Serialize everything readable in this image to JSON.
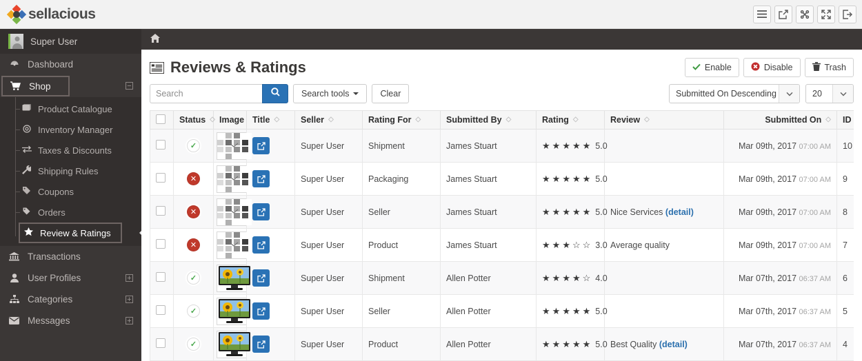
{
  "topbar": {
    "brand": "sellacious",
    "icons": [
      {
        "name": "menu-icon",
        "label": "Menu"
      },
      {
        "name": "external-link-icon",
        "label": "Preview site"
      },
      {
        "name": "joomla-icon",
        "label": "Joomla"
      },
      {
        "name": "fullscreen-icon",
        "label": "Fullscreen"
      },
      {
        "name": "logout-icon",
        "label": "Logout"
      }
    ]
  },
  "sidebar": {
    "user": "Super User",
    "items": [
      {
        "label": "Dashboard",
        "icon": "dashboard-icon",
        "boxed": false,
        "expander": null
      },
      {
        "label": "Shop",
        "icon": "cart-icon",
        "boxed": true,
        "expander": "minus"
      },
      {
        "label": "Transactions",
        "icon": "bank-icon",
        "boxed": false,
        "expander": null
      },
      {
        "label": "User Profiles",
        "icon": "user-icon",
        "boxed": false,
        "expander": "plus"
      },
      {
        "label": "Categories",
        "icon": "sitemap-icon",
        "boxed": false,
        "expander": "plus"
      },
      {
        "label": "Messages",
        "icon": "envelope-icon",
        "boxed": false,
        "expander": "plus"
      }
    ],
    "shop_submenu": [
      {
        "label": "Product Catalogue",
        "icon": "book-icon",
        "active": false
      },
      {
        "label": "Inventory Manager",
        "icon": "circle-icon",
        "active": false
      },
      {
        "label": "Taxes & Discounts",
        "icon": "exchange-icon",
        "active": false
      },
      {
        "label": "Shipping Rules",
        "icon": "wrench-icon",
        "active": false
      },
      {
        "label": "Coupons",
        "icon": "tags-icon",
        "active": false
      },
      {
        "label": "Orders",
        "icon": "tag-icon",
        "active": false
      },
      {
        "label": "Review & Ratings",
        "icon": "star-icon",
        "active": true
      }
    ]
  },
  "breadcrumb": {
    "home_icon": "home-icon"
  },
  "page": {
    "title": "Reviews & Ratings",
    "title_icon": "list-icon",
    "actions": [
      {
        "label": "Enable",
        "icon": "check-icon",
        "color": "#3f9b42"
      },
      {
        "label": "Disable",
        "icon": "times-circle-icon",
        "color": "#c22e2e"
      },
      {
        "label": "Trash",
        "icon": "trash-icon",
        "color": "#3f3f3f"
      }
    ]
  },
  "toolbar": {
    "search_placeholder": "Search",
    "search_value": "",
    "search_icon": "search-icon",
    "search_tools_label": "Search tools",
    "clear_label": "Clear",
    "sort_value": "Submitted On Descending",
    "limit_value": "20"
  },
  "table": {
    "columns": [
      {
        "key": "checkbox",
        "label": "",
        "sortable": false
      },
      {
        "key": "status",
        "label": "Status",
        "sortable": true
      },
      {
        "key": "image",
        "label": "Image",
        "sortable": false
      },
      {
        "key": "title",
        "label": "Title",
        "sortable": true
      },
      {
        "key": "seller",
        "label": "Seller",
        "sortable": true
      },
      {
        "key": "rating_for",
        "label": "Rating For",
        "sortable": true
      },
      {
        "key": "submitted_by",
        "label": "Submitted By",
        "sortable": true
      },
      {
        "key": "rating",
        "label": "Rating",
        "sortable": true
      },
      {
        "key": "review",
        "label": "Review",
        "sortable": true
      },
      {
        "key": "submitted_on",
        "label": "Submitted On",
        "sortable": true
      },
      {
        "key": "id",
        "label": "ID",
        "sortable": true
      }
    ],
    "rows": [
      {
        "status": "enabled",
        "image": "broken-collage",
        "seller": "Super User",
        "rating_for": "Shipment",
        "submitted_by": "James Stuart",
        "rating": 5.0,
        "rating_text": "5.0",
        "review": "",
        "review_link": "",
        "date": "Mar 09th, 2017",
        "time": "07:00 AM",
        "id": "10"
      },
      {
        "status": "disabled",
        "image": "broken-collage",
        "seller": "Super User",
        "rating_for": "Packaging",
        "submitted_by": "James Stuart",
        "rating": 5.0,
        "rating_text": "5.0",
        "review": "",
        "review_link": "",
        "date": "Mar 09th, 2017",
        "time": "07:00 AM",
        "id": "9"
      },
      {
        "status": "disabled",
        "image": "broken-collage",
        "seller": "Super User",
        "rating_for": "Seller",
        "submitted_by": "James Stuart",
        "rating": 5.0,
        "rating_text": "5.0",
        "review": "Nice Services",
        "review_link": "(detail)",
        "date": "Mar 09th, 2017",
        "time": "07:00 AM",
        "id": "8"
      },
      {
        "status": "disabled",
        "image": "broken-collage",
        "seller": "Super User",
        "rating_for": "Product",
        "submitted_by": "James Stuart",
        "rating": 3.0,
        "rating_text": "3.0",
        "review": "Average quality",
        "review_link": "",
        "date": "Mar 09th, 2017",
        "time": "07:00 AM",
        "id": "7"
      },
      {
        "status": "enabled",
        "image": "tv-sunflower",
        "seller": "Super User",
        "rating_for": "Shipment",
        "submitted_by": "Allen Potter",
        "rating": 4.0,
        "rating_text": "4.0",
        "review": "",
        "review_link": "",
        "date": "Mar 07th, 2017",
        "time": "06:37 AM",
        "id": "6"
      },
      {
        "status": "enabled",
        "image": "tv-sunflower",
        "seller": "Super User",
        "rating_for": "Seller",
        "submitted_by": "Allen Potter",
        "rating": 5.0,
        "rating_text": "5.0",
        "review": "",
        "review_link": "",
        "date": "Mar 07th, 2017",
        "time": "06:37 AM",
        "id": "5"
      },
      {
        "status": "enabled",
        "image": "tv-sunflower",
        "seller": "Super User",
        "rating_for": "Product",
        "submitted_by": "Allen Potter",
        "rating": 5.0,
        "rating_text": "5.0",
        "review": "Best Quality",
        "review_link": "(detail)",
        "date": "Mar 07th, 2017",
        "time": "06:37 AM",
        "id": "4"
      }
    ]
  },
  "colors": {
    "brand_blue": "#2a72b5",
    "sidebar_bg": "#3b3736",
    "enabled_green": "#4aa84d",
    "disabled_red": "#c0392b"
  }
}
